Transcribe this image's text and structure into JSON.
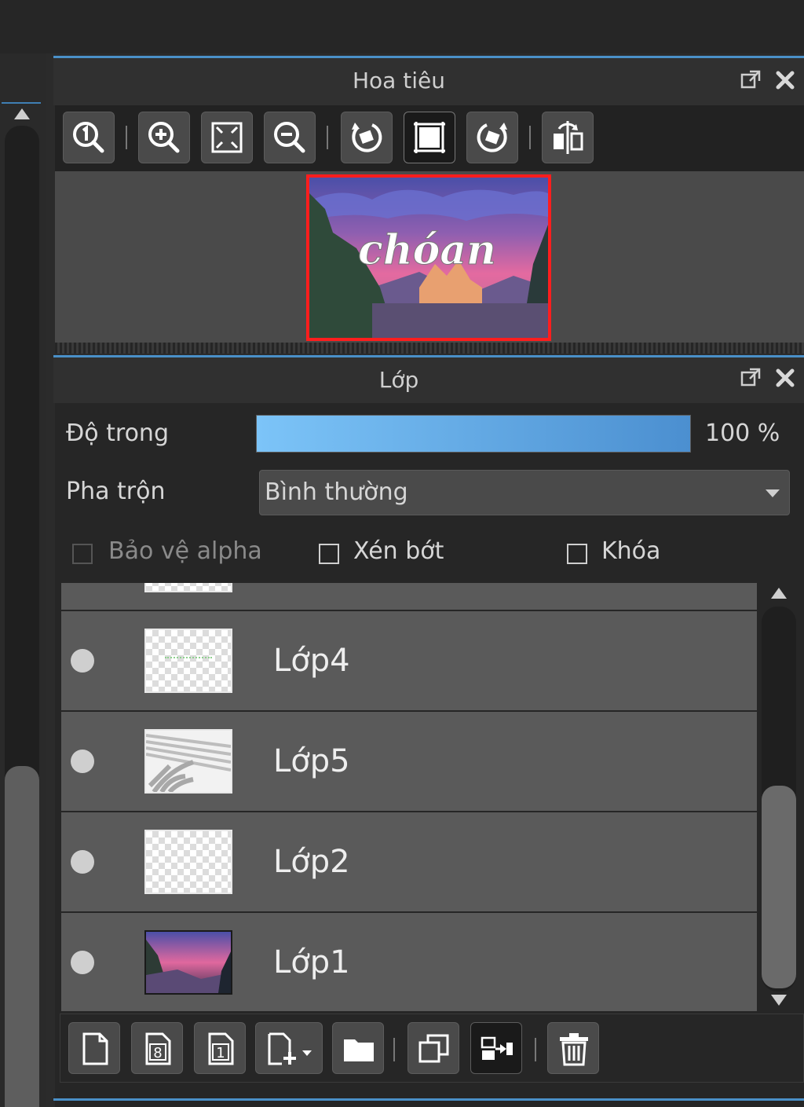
{
  "navigator": {
    "title": "Hoa tiêu",
    "preview_text": "chóan",
    "toolbar": [
      {
        "icon": "zoom-actual-icon"
      },
      {
        "icon": "zoom-in-icon"
      },
      {
        "icon": "fit-screen-icon"
      },
      {
        "icon": "zoom-out-icon"
      },
      {
        "icon": "rotate-left-icon"
      },
      {
        "icon": "reset-view-icon"
      },
      {
        "icon": "rotate-right-icon"
      },
      {
        "icon": "flip-horizontal-icon"
      }
    ]
  },
  "layers": {
    "title": "Lớp",
    "opacity_label": "Độ trong",
    "opacity_value": "100 %",
    "opacity_percent": 100,
    "blend_label": "Pha trộn",
    "blend_value": "Bình thường",
    "checkbox_alpha": "Bảo vệ alpha",
    "checkbox_clip": "Xén bớt",
    "checkbox_lock": "Khóa",
    "items": [
      {
        "name": "Lớp4",
        "thumb": "transparent"
      },
      {
        "name": "Lớp5",
        "thumb": "leaf-shadow"
      },
      {
        "name": "Lớp2",
        "thumb": "transparent"
      },
      {
        "name": "Lớp1",
        "thumb": "sunset"
      }
    ]
  },
  "colors": {
    "accent": "#4a90c8",
    "selection_frame": "#ff1d1d",
    "opacity_start": "#7cc4f8",
    "opacity_end": "#4b8fd0"
  }
}
